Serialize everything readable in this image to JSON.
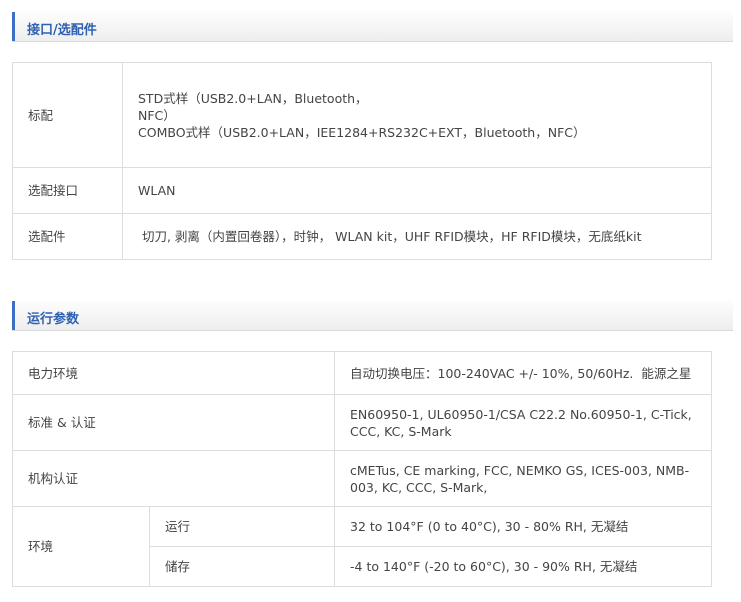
{
  "section1": {
    "title": "接口/选配件",
    "rows": [
      {
        "label": "标配",
        "value_lines": [
          "STD式样（USB2.0+LAN，Bluetooth，",
          "NFC）",
          "COMBO式样（USB2.0+LAN，IEE1284+RS232C+EXT，Bluetooth，NFC）"
        ]
      },
      {
        "label": "选配接口",
        "value": "WLAN"
      },
      {
        "label": "选配件",
        "value": " 切刀, 剥离（内置回卷器），时钟， WLAN kit，UHF RFID模块，HF RFID模块，无底纸kit"
      }
    ]
  },
  "section2": {
    "title": "运行参数",
    "rows": [
      {
        "label": "电力环境",
        "value": "自动切换电压：100-240VAC +/- 10%, 50/60Hz.  能源之星"
      },
      {
        "label": "标准 & 认证",
        "value": "EN60950-1, UL60950-1/CSA C22.2 No.60950-1, C-Tick, CCC, KC, S-Mark"
      },
      {
        "label": "机构认证",
        "value": "cMETus, CE marking, FCC, NEMKO GS, ICES-003, NMB-003, KC, CCC, S-Mark,"
      },
      {
        "label": "环境",
        "sub": [
          {
            "label": "运行",
            "value": "32 to 104°F (0 to 40°C), 30 - 80% RH, 无凝结"
          },
          {
            "label": "储存",
            "value": "-4 to 140°F (-20 to 60°C), 30 - 90% RH, 无凝结"
          }
        ]
      }
    ]
  }
}
